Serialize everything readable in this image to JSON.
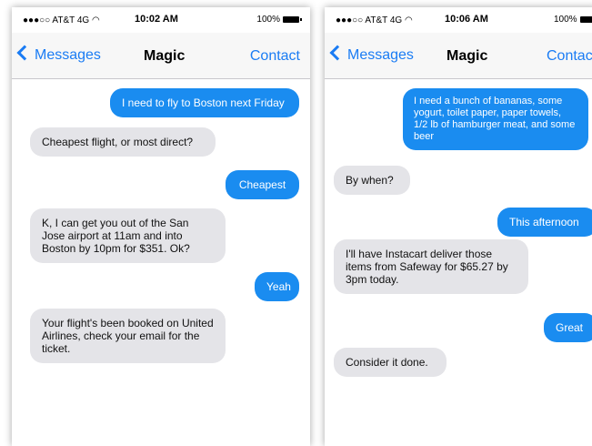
{
  "status": {
    "carrier": "●●●○○ AT&T 4G ◠",
    "battery": "100%"
  },
  "left_phone": {
    "time": "10:02 AM",
    "back_label": "Messages",
    "title": "Magic",
    "contact_label": "Contact",
    "messages": [
      {
        "from": "me",
        "text": "I need to fly to Boston next Friday"
      },
      {
        "from": "magic",
        "text": "Cheapest flight, or most direct?"
      },
      {
        "from": "me",
        "text": "Cheapest"
      },
      {
        "from": "magic",
        "text": "K, I can get you out of the San Jose airport at 11am and into Boston by 10pm for $351. Ok?"
      },
      {
        "from": "me",
        "text": "Yeah"
      },
      {
        "from": "magic",
        "text": "Your flight's been booked on United Airlines, check your email for the ticket."
      }
    ]
  },
  "right_phone": {
    "time": "10:06 AM",
    "back_label": "Messages",
    "title": "Magic",
    "contact_label": "Contac",
    "messages": [
      {
        "from": "me",
        "text": "I need a bunch of bananas, some yogurt, toilet paper, paper towels, 1/2 lb of hamburger meat, and some beer"
      },
      {
        "from": "magic",
        "text": "By when?"
      },
      {
        "from": "me",
        "text": "This afternoon"
      },
      {
        "from": "magic",
        "text": "I'll have Instacart deliver those items from Safeway for $65.27 by 3pm today."
      },
      {
        "from": "me",
        "text": "Great"
      },
      {
        "from": "magic",
        "text": "Consider it done."
      }
    ]
  }
}
